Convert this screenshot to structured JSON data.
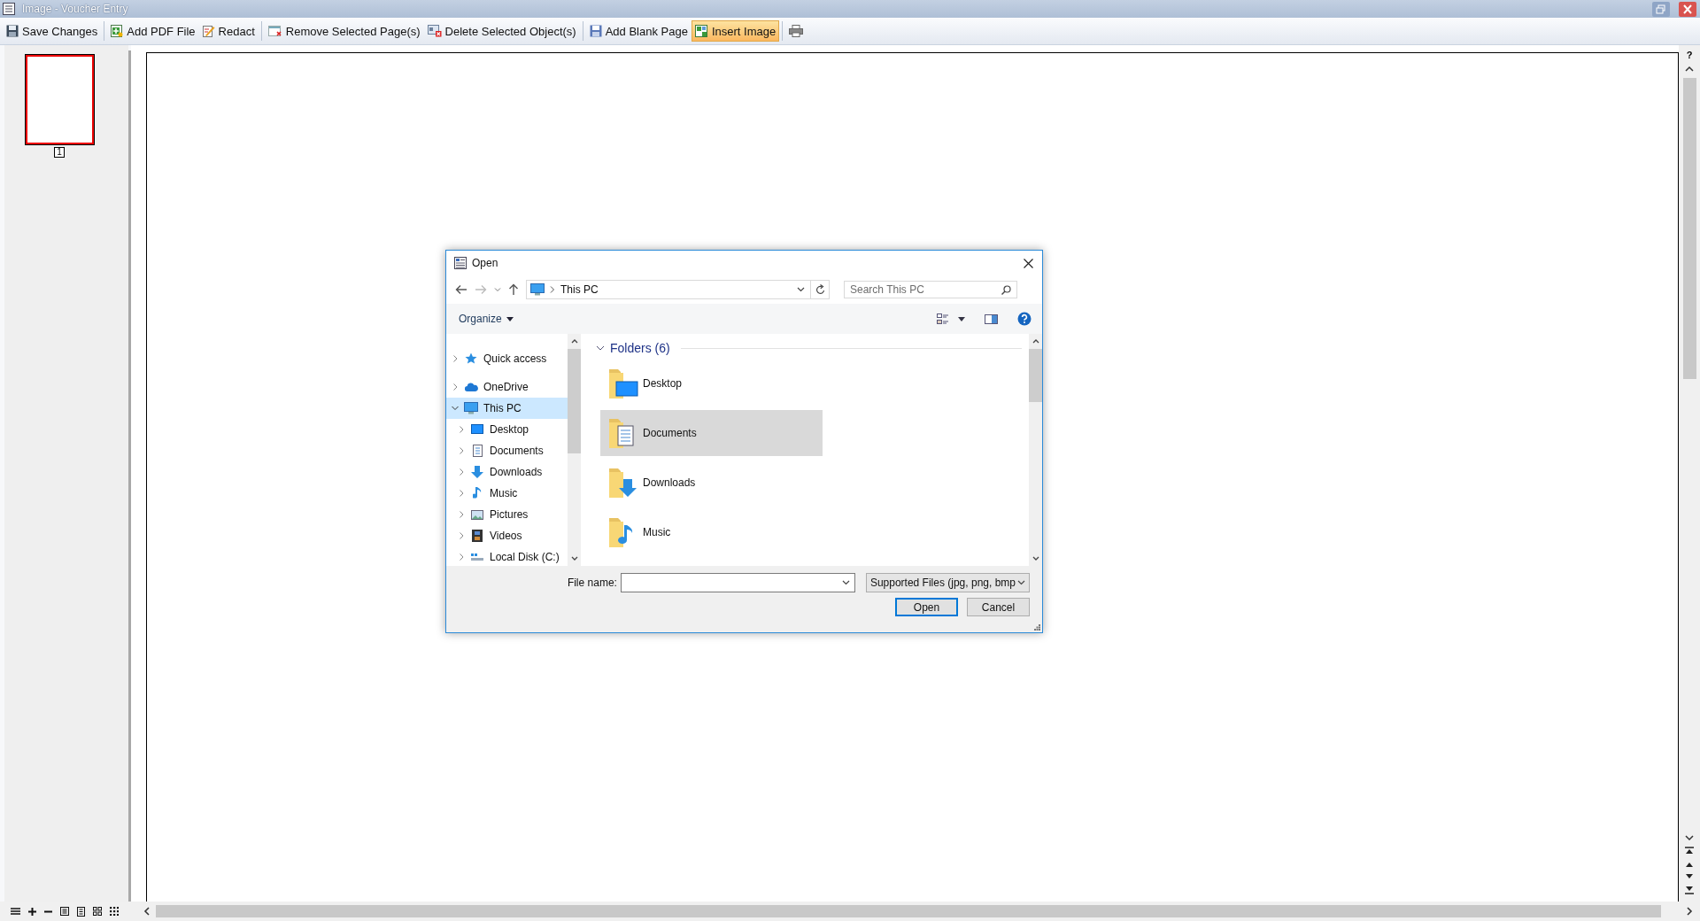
{
  "window": {
    "title": "Image - Voucher Entry"
  },
  "toolbar_groups": [
    [
      {
        "label": "Save Changes",
        "kind": "save",
        "selected": false
      }
    ],
    [
      {
        "label": "Add PDF File",
        "kind": "add-pdf",
        "selected": false
      },
      {
        "label": "Redact",
        "kind": "redact",
        "selected": false
      }
    ],
    [
      {
        "label": "Remove Selected Page(s)",
        "kind": "remove-page",
        "selected": false
      },
      {
        "label": "Delete Selected Object(s)",
        "kind": "delete-object",
        "selected": false
      }
    ],
    [
      {
        "label": "Add Blank Page",
        "kind": "blank-page",
        "selected": false
      },
      {
        "label": "Insert Image",
        "kind": "insert-image",
        "selected": true
      }
    ],
    [
      {
        "kind": "print",
        "selected": false
      }
    ]
  ],
  "thumbnails": [
    {
      "label": "1",
      "selected": true
    }
  ],
  "help_mark": "?",
  "dialog": {
    "title": "Open",
    "address": {
      "path": "This PC"
    },
    "search": {
      "placeholder": "Search This PC"
    },
    "organize": "Organize",
    "nav": [
      {
        "label": "Quick access",
        "kind": "star",
        "expanded": false,
        "selected": false
      },
      {
        "label": "OneDrive",
        "kind": "cloud",
        "expanded": false,
        "selected": false
      },
      {
        "label": "This PC",
        "kind": "pc",
        "expanded": true,
        "selected": true,
        "children": [
          {
            "label": "Desktop",
            "kind": "desktop",
            "expanded": false,
            "selected": false
          },
          {
            "label": "Documents",
            "kind": "documents",
            "expanded": false,
            "selected": false
          },
          {
            "label": "Downloads",
            "kind": "downloads",
            "expanded": false,
            "selected": false
          },
          {
            "label": "Music",
            "kind": "music",
            "expanded": false,
            "selected": false
          },
          {
            "label": "Pictures",
            "kind": "pictures",
            "expanded": false,
            "selected": false
          },
          {
            "label": "Videos",
            "kind": "videos",
            "expanded": false,
            "selected": false
          },
          {
            "label": "Local Disk (C:)",
            "kind": "disk",
            "expanded": false,
            "selected": false
          }
        ]
      }
    ],
    "folders_header": {
      "label": "Folders (6)",
      "expanded": true
    },
    "folders": [
      {
        "label": "Desktop",
        "kind": "desktop",
        "selected": false
      },
      {
        "label": "Documents",
        "kind": "documents",
        "selected": true
      },
      {
        "label": "Downloads",
        "kind": "downloads",
        "selected": false
      },
      {
        "label": "Music",
        "kind": "music",
        "selected": false
      }
    ],
    "file_name_label": "File name:",
    "filter": "Supported Files (jpg, png, bmp",
    "buttons": [
      {
        "label": "Open",
        "default": true
      },
      {
        "label": "Cancel",
        "default": false
      }
    ]
  }
}
